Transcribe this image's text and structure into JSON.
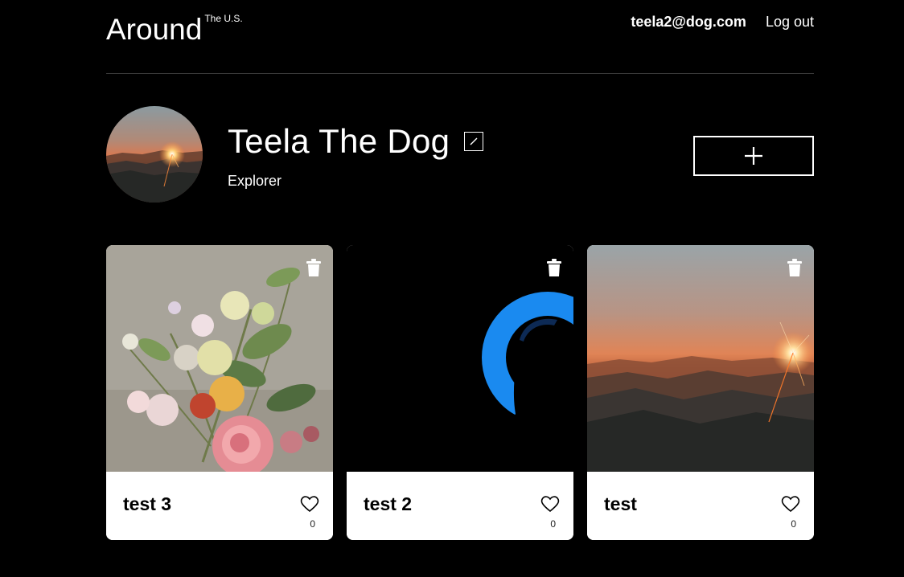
{
  "header": {
    "logo": "Around",
    "logo_sup": "The U.S.",
    "email": "teela2@dog.com",
    "logout_label": "Log out"
  },
  "profile": {
    "name": "Teela The Dog",
    "role": "Explorer"
  },
  "cards": [
    {
      "title": "test 3",
      "likes": "0",
      "image": "flower-painting"
    },
    {
      "title": "test 2",
      "likes": "0",
      "image": "silhouette-blue-ring"
    },
    {
      "title": "test",
      "likes": "0",
      "image": "mountain-sunset"
    }
  ]
}
